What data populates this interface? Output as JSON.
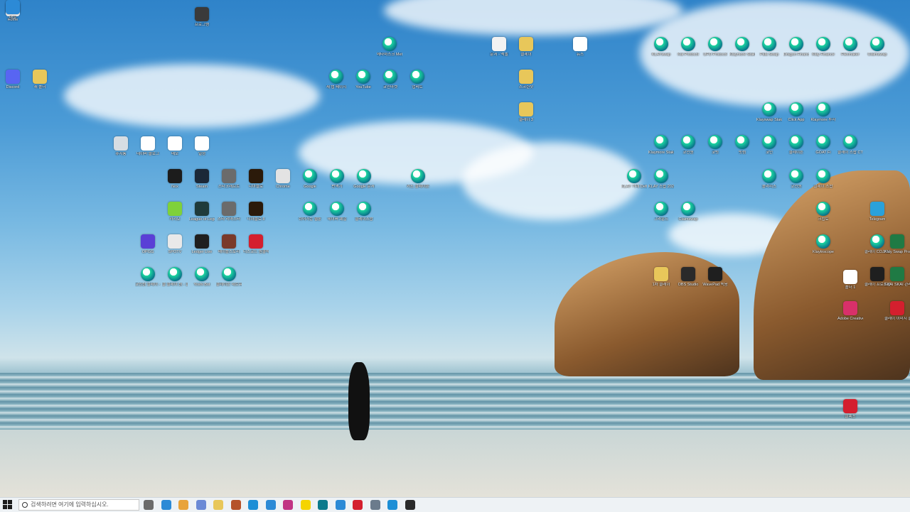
{
  "desktop": {
    "icons": [
      {
        "label": "Home",
        "color": "#f2f2f2",
        "kind": "app"
      },
      {
        "label": "프로그램",
        "color": "#3a3a3a",
        "kind": "app"
      },
      {
        "label": "Discord",
        "color": "#5865f2",
        "kind": "app"
      },
      {
        "label": "새 폴더",
        "color": "#e8c75a",
        "kind": "app"
      },
      {
        "label": "메타마스크 Metamask",
        "color": "#0b2a52",
        "kind": "circle"
      },
      {
        "label": "새 탭 페이지",
        "color": "#0b2a52",
        "kind": "circle"
      },
      {
        "label": "YouTube",
        "color": "#0b2a52",
        "kind": "circle"
      },
      {
        "label": "코인마켓",
        "color": "#0b2a52",
        "kind": "circle"
      },
      {
        "label": "업비트",
        "color": "#0b2a52",
        "kind": "circle"
      },
      {
        "label": "휴지통",
        "color": "#d6dde3",
        "kind": "app"
      },
      {
        "label": "네이버 블로그",
        "color": "#ffffff",
        "kind": "app"
      },
      {
        "label": "메모",
        "color": "#ffffff",
        "kind": "app"
      },
      {
        "label": "일정",
        "color": "#ffffff",
        "kind": "app"
      },
      {
        "label": "Nox",
        "color": "#1c1c1c",
        "kind": "app"
      },
      {
        "label": "Steam",
        "color": "#1b2838",
        "kind": "app"
      },
      {
        "label": "스타크래프트",
        "color": "#6b6b6b",
        "kind": "app"
      },
      {
        "label": "디아블로",
        "color": "#2b1a0a",
        "kind": "app"
      },
      {
        "label": "Chrome",
        "color": "#e3e3e3",
        "kind": "app"
      },
      {
        "label": "Google",
        "color": "#0b2a52",
        "kind": "circle"
      },
      {
        "label": "번역기",
        "color": "#0b2a52",
        "kind": "circle"
      },
      {
        "label": "Google 문서",
        "color": "#0b2a52",
        "kind": "circle"
      },
      {
        "label": "카드 클레이튼",
        "color": "#0b2a52",
        "kind": "circle"
      },
      {
        "label": "카카오",
        "color": "#7fd13a",
        "kind": "app"
      },
      {
        "label": "League of Legends",
        "color": "#1f3b3a",
        "kind": "app"
      },
      {
        "label": "스타 리마스터",
        "color": "#6b6b6b",
        "kind": "app"
      },
      {
        "label": "디아블로 II",
        "color": "#2b1a0a",
        "kind": "app"
      },
      {
        "label": "쉬어가는 웹툰",
        "color": "#0b2a52",
        "kind": "circle"
      },
      {
        "label": "네이버 웨일",
        "color": "#0b2a52",
        "kind": "circle"
      },
      {
        "label": "클레이스왑",
        "color": "#0b2a52",
        "kind": "circle"
      },
      {
        "label": "OPGG",
        "color": "#5a3fd6",
        "kind": "app"
      },
      {
        "label": "SPOTV",
        "color": "#e9e9e9",
        "kind": "app"
      },
      {
        "label": "Ledger Live",
        "color": "#1f1f1f",
        "kind": "app"
      },
      {
        "label": "메이플스토리",
        "color": "#7a3a2a",
        "kind": "app"
      },
      {
        "label": "디스코드 원클릭",
        "color": "#d41f2e",
        "kind": "app"
      },
      {
        "label": "코인원 클레이 - League",
        "color": "#0b2a52",
        "kind": "circle"
      },
      {
        "label": "클 클레이 원 - 클레이",
        "color": "#0b2a52",
        "kind": "circle"
      },
      {
        "label": "Yoshi Bot",
        "color": "#0b2a52",
        "kind": "circle"
      },
      {
        "label": "클레이튼 네트워크",
        "color": "#0b2a52",
        "kind": "circle"
      },
      {
        "label": "문서 - 엑셀",
        "color": "#f2f2f2",
        "kind": "app"
      },
      {
        "label": "클레이",
        "color": "#e8c75a",
        "kind": "app"
      },
      {
        "label": "스크린샷",
        "color": "#e8c75a",
        "kind": "app"
      },
      {
        "label": "클레이 3",
        "color": "#e8c75a",
        "kind": "app"
      },
      {
        "label": "뉴스",
        "color": "#ffffff",
        "kind": "app"
      },
      {
        "label": "KLAY 거래 Definix",
        "color": "#0b2a52",
        "kind": "circle"
      },
      {
        "label": "KLAY 스왑 2020.09",
        "color": "#0b2a52",
        "kind": "circle"
      },
      {
        "label": "그라운드",
        "color": "#0b2a52",
        "kind": "circle"
      },
      {
        "label": "Claimswap",
        "color": "#0b2a52",
        "kind": "circle"
      },
      {
        "label": "1차 클레이",
        "color": "#e8c75a",
        "kind": "app"
      },
      {
        "label": "OBS Studio",
        "color": "#2a2a2a",
        "kind": "app"
      },
      {
        "label": "WavePad 녹음",
        "color": "#1f1f1f",
        "kind": "app"
      },
      {
        "label": "KLAYswap",
        "color": "#0b2a52",
        "kind": "circle"
      },
      {
        "label": "Kai Protocol",
        "color": "#0b2a52",
        "kind": "circle"
      },
      {
        "label": "UFO Protocol",
        "color": "#0b2a52",
        "kind": "circle"
      },
      {
        "label": "Klaymore Stakehouse",
        "color": "#0b2a52",
        "kind": "circle"
      },
      {
        "label": "Pala Swap",
        "color": "#0b2a52",
        "kind": "circle"
      },
      {
        "label": "Dragon Finance",
        "color": "#0b2a52",
        "kind": "circle"
      },
      {
        "label": "Klay Finance",
        "color": "#0b2a52",
        "kind": "circle"
      },
      {
        "label": "Flexmaker",
        "color": "#0b2a52",
        "kind": "circle"
      },
      {
        "label": "Claimswap",
        "color": "#0b2a52",
        "kind": "circle"
      },
      {
        "label": "Klayswap Stakehouse",
        "color": "#0b2a52",
        "kind": "circle"
      },
      {
        "label": "Click App",
        "color": "#0b2a52",
        "kind": "circle"
      },
      {
        "label": "Klaymore 투자",
        "color": "#0b2a52",
        "kind": "circle"
      },
      {
        "label": "Klaymore Stakehouse",
        "color": "#0b2a52",
        "kind": "circle"
      },
      {
        "label": "코인원",
        "color": "#0b2a52",
        "kind": "circle"
      },
      {
        "label": "코빗",
        "color": "#0b2a52",
        "kind": "circle"
      },
      {
        "label": "빗썸",
        "color": "#0b2a52",
        "kind": "circle"
      },
      {
        "label": "코인",
        "color": "#0b2a52",
        "kind": "circle"
      },
      {
        "label": "클레이튼",
        "color": "#0b2a52",
        "kind": "circle"
      },
      {
        "label": "GOAT Fi",
        "color": "#0b2a52",
        "kind": "circle"
      },
      {
        "label": "클레이 스왑 CT",
        "color": "#0b2a52",
        "kind": "circle"
      },
      {
        "label": "폴라리스",
        "color": "#0b2a52",
        "kind": "circle"
      },
      {
        "label": "코인원",
        "color": "#0b2a52",
        "kind": "circle"
      },
      {
        "label": "클레이 스왑",
        "color": "#0b2a52",
        "kind": "circle"
      },
      {
        "label": "크립토",
        "color": "#0b2a52",
        "kind": "circle"
      },
      {
        "label": "Telegram",
        "color": "#2aa1da",
        "kind": "app"
      },
      {
        "label": "Klaytnscope",
        "color": "#0b2a52",
        "kind": "circle"
      },
      {
        "label": "클레이 COJAM - Blockchai",
        "color": "#0b2a52",
        "kind": "circle"
      },
      {
        "label": "Klay Swap Protocol",
        "color": "#1f7a44",
        "kind": "app"
      },
      {
        "label": "폴더 1",
        "color": "#ffffff",
        "kind": "app"
      },
      {
        "label": "클레이 프로토콜",
        "color": "#1f1f1f",
        "kind": "app"
      },
      {
        "label": "SKAI SKAI 관리",
        "color": "#1f7a44",
        "kind": "app"
      },
      {
        "label": "Adobe Creative",
        "color": "#d8306a",
        "kind": "app"
      },
      {
        "label": "클레이 이미지 클레이",
        "color": "#d41f2e",
        "kind": "app"
      },
      {
        "label": "클렉스",
        "color": "#d41f2e",
        "kind": "app"
      },
      {
        "label": "메일",
        "color": "#2c8ad6",
        "kind": "app"
      }
    ]
  },
  "taskbar": {
    "search_placeholder": "검색하려면 여기에 입력하십시오.",
    "apps": [
      {
        "name": "task-view",
        "color": "#6b6b6b"
      },
      {
        "name": "store",
        "color": "#2c8ad6"
      },
      {
        "name": "chrome",
        "color": "#e8a33a"
      },
      {
        "name": "whale",
        "color": "#6b8ad6"
      },
      {
        "name": "file-explorer",
        "color": "#e8c75a"
      },
      {
        "name": "terminal",
        "color": "#b5522a"
      },
      {
        "name": "edge",
        "color": "#1d8fd6"
      },
      {
        "name": "document",
        "color": "#2c8ad6"
      },
      {
        "name": "instagram",
        "color": "#c13584"
      },
      {
        "name": "kakao",
        "color": "#f5d400"
      },
      {
        "name": "klay",
        "color": "#0b7a8c"
      },
      {
        "name": "notepad",
        "color": "#2c8ad6"
      },
      {
        "name": "red-app",
        "color": "#d41f2e"
      },
      {
        "name": "calculator",
        "color": "#6b7b8c"
      },
      {
        "name": "browser",
        "color": "#1d8fd6"
      },
      {
        "name": "obs",
        "color": "#2a2a2a"
      }
    ]
  }
}
